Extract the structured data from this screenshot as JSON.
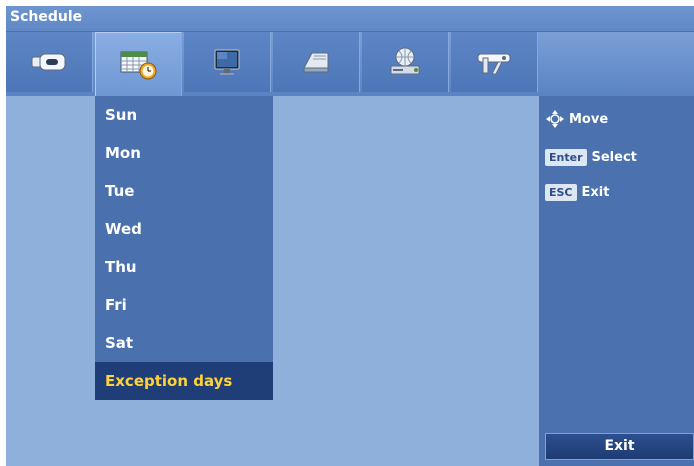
{
  "window": {
    "title": "Schedule"
  },
  "tabs": [
    {
      "icon": "camera-icon",
      "active": false
    },
    {
      "icon": "schedule-calendar-icon",
      "active": true
    },
    {
      "icon": "monitor-icon",
      "active": false
    },
    {
      "icon": "storage-icon",
      "active": false
    },
    {
      "icon": "network-icon",
      "active": false
    },
    {
      "icon": "tools-icon",
      "active": false
    }
  ],
  "menu": {
    "items": [
      "Sun",
      "Mon",
      "Tue",
      "Wed",
      "Thu",
      "Fri",
      "Sat",
      "Exception days"
    ],
    "selected_index": 7
  },
  "hints": {
    "move_label": "Move",
    "enter_key": "Enter",
    "select_label": "Select",
    "esc_key": "ESC",
    "exit_label": "Exit"
  },
  "exit_button": {
    "label": "Exit"
  },
  "colors": {
    "background": "#8fb0da",
    "panel": "#4a70ad",
    "selected": "#1f3e78",
    "selected_text": "#ffd23a"
  }
}
